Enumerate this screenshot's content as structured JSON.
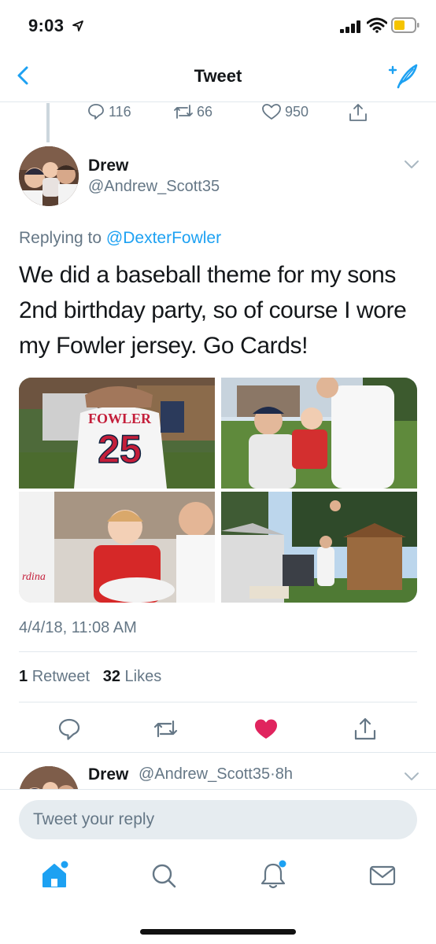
{
  "status_bar": {
    "time": "9:03"
  },
  "nav": {
    "title": "Tweet"
  },
  "parent_tweet": {
    "reply_count": "116",
    "retweet_count": "66",
    "like_count": "950"
  },
  "tweet": {
    "author_name": "Drew",
    "author_handle": "@Andrew_Scott35",
    "replying_prefix": "Replying to ",
    "replying_to": "@DexterFowler",
    "text": "We did a baseball theme for my sons 2nd birthday party, so of course I wore my Fowler jersey. Go Cards!",
    "timestamp": "4/4/18, 11:08 AM",
    "retweet_count": "1",
    "retweet_label": "Retweet",
    "like_count": "32",
    "like_label": "Likes",
    "liked": true,
    "photos": {
      "jersey_name": "FOWLER",
      "jersey_number": "25"
    }
  },
  "next_reply": {
    "author_name": "Drew",
    "author_handle": "@Andrew_Scott35",
    "separator": "·",
    "age": "8h"
  },
  "composer": {
    "placeholder": "Tweet your reply"
  },
  "colors": {
    "accent": "#1da1f2",
    "like": "#e0245e",
    "text": "#14171a",
    "muted": "#657786"
  }
}
